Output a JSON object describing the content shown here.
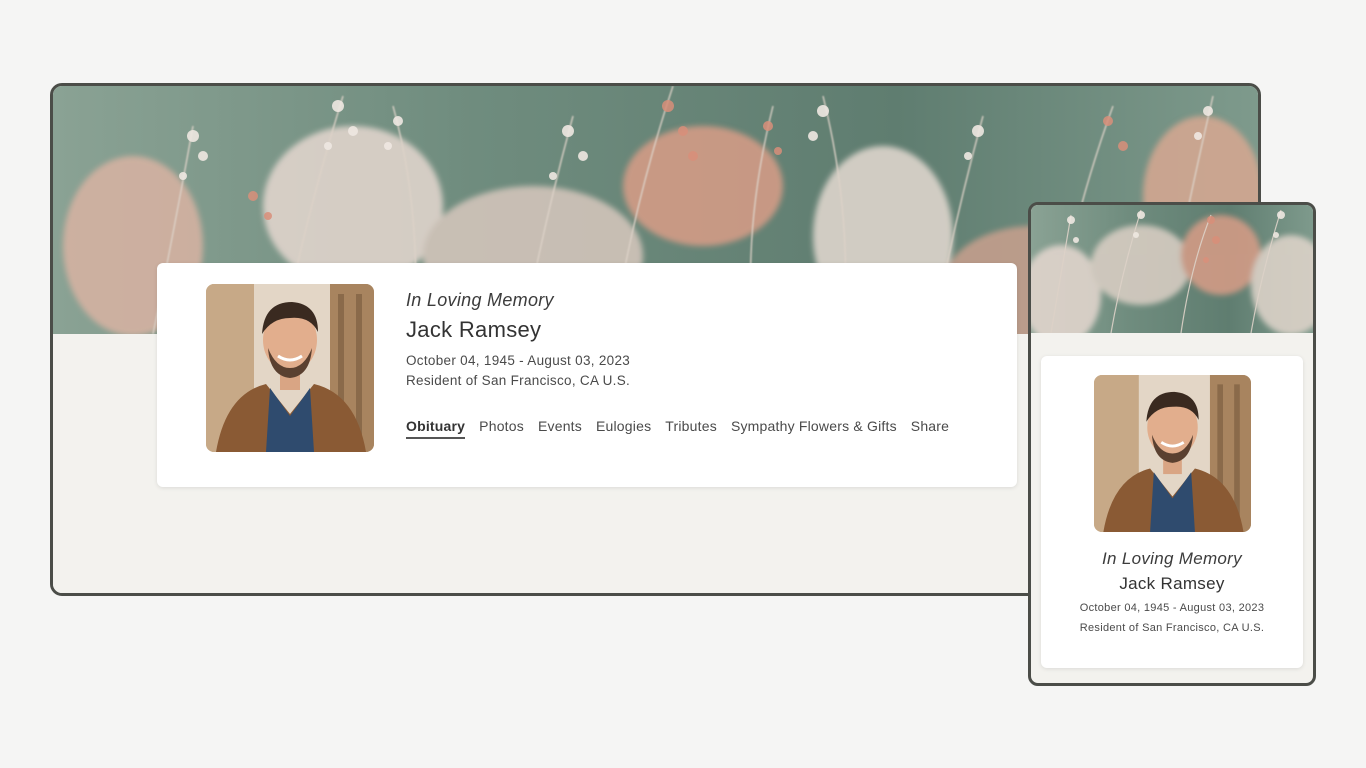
{
  "colors": {
    "page_background": "#f5f5f4",
    "frame_border": "#4b4d48",
    "content_background": "#f3f2ee",
    "card_background": "#ffffff",
    "hero_green": "#6f8c7e",
    "hero_pink": "#d9a08c"
  },
  "hero": {
    "image": "wildflower-grass-banner"
  },
  "desktop": {
    "memorial": {
      "portrait": "portrait-photo",
      "memory_line": "In Loving Memory",
      "name": "Jack Ramsey",
      "dates": "October 04, 1945 - August 03, 2023",
      "residence": "Resident of San Francisco, CA U.S."
    },
    "nav": {
      "items": [
        {
          "label": "Obituary",
          "active": true
        },
        {
          "label": "Photos",
          "active": false
        },
        {
          "label": "Events",
          "active": false
        },
        {
          "label": "Eulogies",
          "active": false
        },
        {
          "label": "Tributes",
          "active": false
        },
        {
          "label": "Sympathy Flowers & Gifts",
          "active": false
        },
        {
          "label": "Share",
          "active": false
        }
      ]
    }
  },
  "mobile": {
    "memorial": {
      "portrait": "portrait-photo",
      "memory_line": "In Loving Memory",
      "name": "Jack Ramsey",
      "dates": "October 04, 1945 - August 03, 2023",
      "residence": "Resident of San Francisco, CA U.S."
    }
  }
}
